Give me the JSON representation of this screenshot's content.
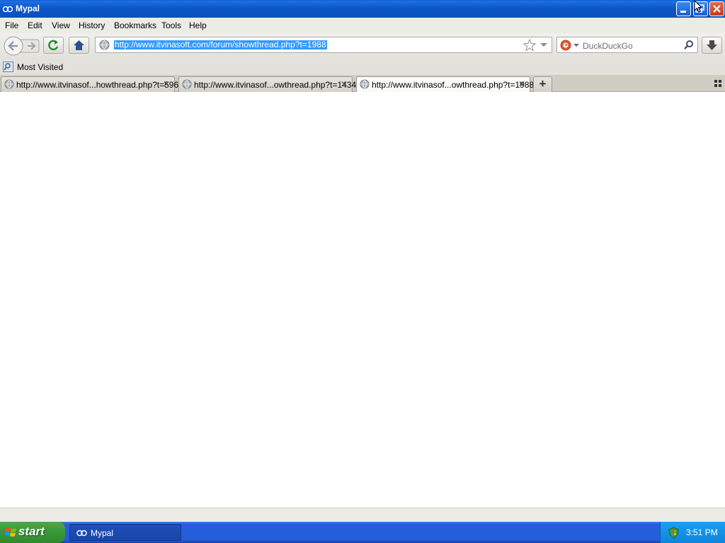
{
  "window": {
    "title": "Mypal"
  },
  "menu": [
    "File",
    "Edit",
    "View",
    "History",
    "Bookmarks",
    "Tools",
    "Help"
  ],
  "urlbar": {
    "url": "http://www.itvinasoft.com/forum/showthread.php?t=1988"
  },
  "search": {
    "placeholder": "DuckDuckGo"
  },
  "bookmarks": {
    "most_visited": "Most Visited"
  },
  "tabs": [
    {
      "label": "http://www.itvinasof...howthread.php?t=596"
    },
    {
      "label": "http://www.itvinasof...owthread.php?t=1434"
    },
    {
      "label": "http://www.itvinasof...owthread.php?t=1988"
    }
  ],
  "taskbar": {
    "start_label": "start",
    "task_label": "Mypal",
    "clock": "3:51 PM"
  },
  "colors": {
    "accent": "#0a4fbf",
    "selection": "#3399ff",
    "start": "#3c9a39"
  }
}
